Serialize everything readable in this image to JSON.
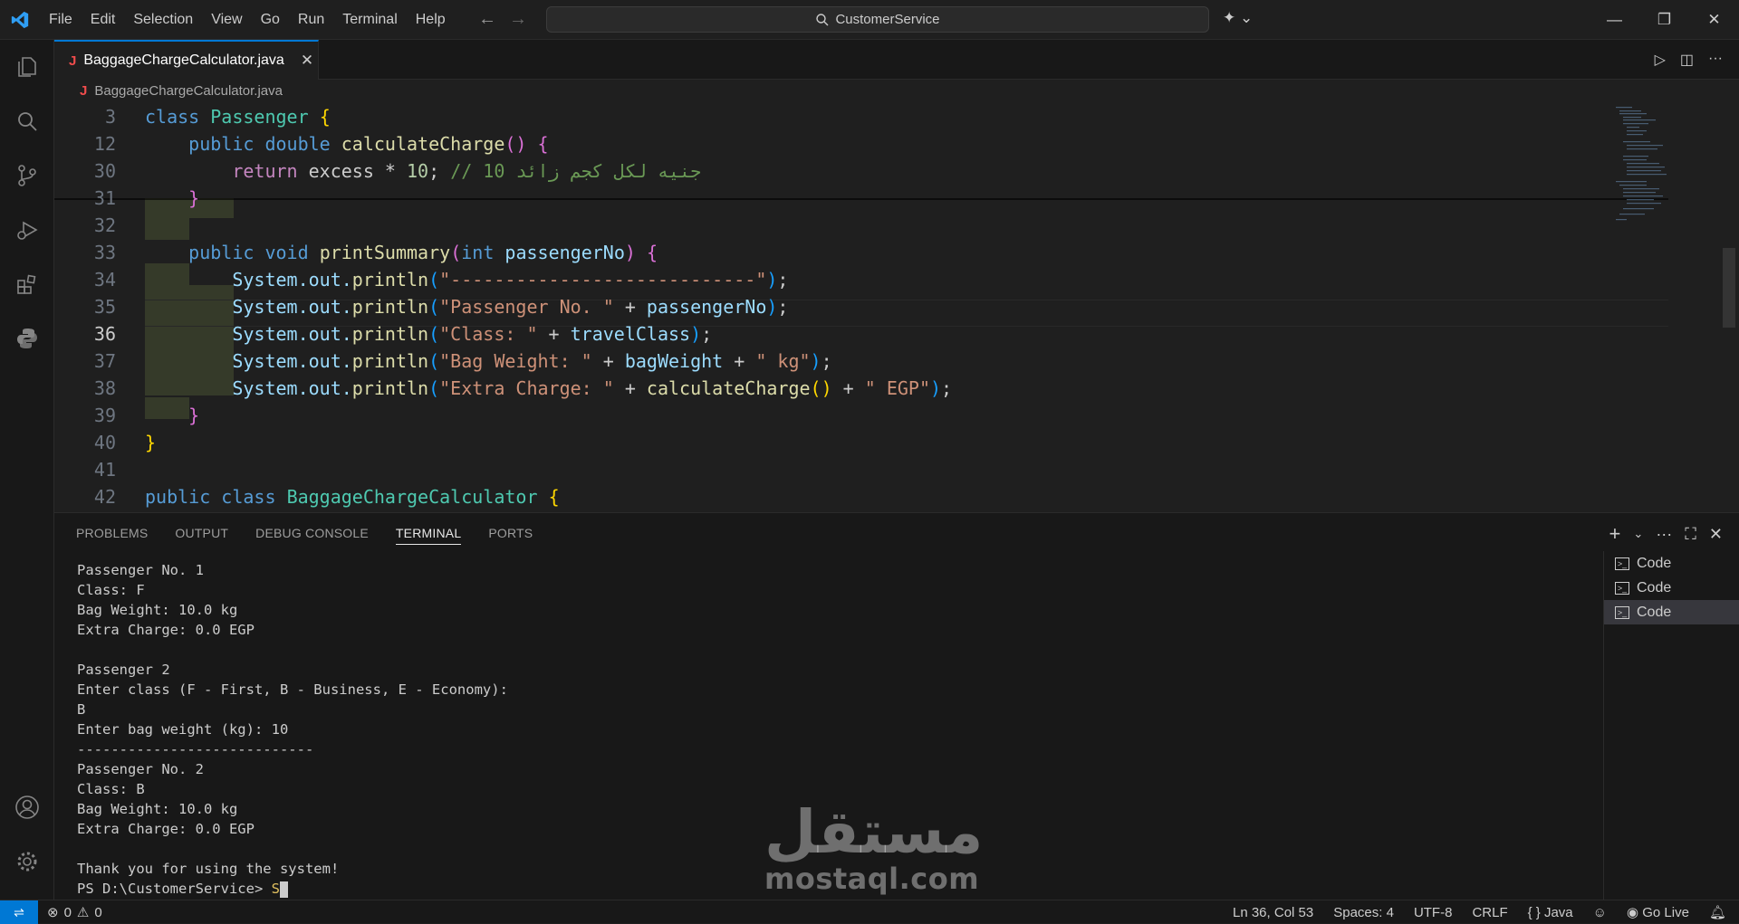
{
  "titlebar": {
    "menu": [
      "File",
      "Edit",
      "Selection",
      "View",
      "Go",
      "Run",
      "Terminal",
      "Help"
    ],
    "search_text": "CustomerService"
  },
  "editor": {
    "tab_label": "BaggageChargeCalculator.java",
    "breadcrumb": "BaggageChargeCalculator.java",
    "lines": [
      {
        "n": "3",
        "current": false
      },
      {
        "n": "12",
        "current": false
      },
      {
        "n": "30",
        "current": false
      },
      {
        "n": "31",
        "current": false
      },
      {
        "n": "32",
        "current": false
      },
      {
        "n": "33",
        "current": false
      },
      {
        "n": "34",
        "current": false
      },
      {
        "n": "35",
        "current": false
      },
      {
        "n": "36",
        "current": true
      },
      {
        "n": "37",
        "current": false
      },
      {
        "n": "38",
        "current": false
      },
      {
        "n": "39",
        "current": false
      },
      {
        "n": "40",
        "current": false
      },
      {
        "n": "41",
        "current": false
      },
      {
        "n": "42",
        "current": false
      }
    ],
    "code": {
      "l3": {
        "kw": "class",
        "name": "Passenger",
        "brace": "{"
      },
      "l12": {
        "kw1": "public",
        "kw2": "double",
        "fn": "calculateCharge",
        "parens": "()",
        "brace": "{"
      },
      "l30": {
        "kw": "return",
        "rest": "excess * ",
        "num": "10",
        "semi": ";",
        "comment": "// 10 جنيه لكل كجم زائد"
      },
      "l31": {
        "brace": "}"
      },
      "l33": {
        "kw1": "public",
        "kw2": "void",
        "fn": "printSummary",
        "p1": "(",
        "ty": "int",
        "param": "passengerNo",
        "p2": ")",
        "brace": "{"
      },
      "l34": {
        "obj": "System.out.",
        "fn": "println",
        "p1": "(",
        "str": "\"----------------------------\"",
        "p2": ")",
        "semi": ";"
      },
      "l35": {
        "obj": "System.out.",
        "fn": "println",
        "p1": "(",
        "str": "\"Passenger No. \"",
        "op": " + ",
        "var": "passengerNo",
        "p2": ")",
        "semi": ";"
      },
      "l36": {
        "obj": "System.out.",
        "fn": "println",
        "p1": "(",
        "str": "\"Class: \"",
        "op": " + ",
        "var": "travelClass",
        "p2": ")",
        "semi": ";"
      },
      "l37": {
        "obj": "System.out.",
        "fn": "println",
        "p1": "(",
        "str": "\"Bag Weight: \"",
        "op": " + ",
        "var": "bagWeight",
        "op2": " + ",
        "str2": "\" kg\"",
        "p2": ")",
        "semi": ";"
      },
      "l38": {
        "obj": "System.out.",
        "fn": "println",
        "p1": "(",
        "str": "\"Extra Charge: \"",
        "op": " + ",
        "fn2": "calculateCharge",
        "pp": "()",
        "op2": " + ",
        "str2": "\" EGP\"",
        "p2": ")",
        "semi": ";"
      },
      "l39": {
        "brace": "}"
      },
      "l40": {
        "brace": "}"
      },
      "l42": {
        "kw1": "public",
        "kw2": "class",
        "name": "BaggageChargeCalculator",
        "brace": "{"
      }
    }
  },
  "panel": {
    "tabs": [
      "PROBLEMS",
      "OUTPUT",
      "DEBUG CONSOLE",
      "TERMINAL",
      "PORTS"
    ],
    "active_tab": "TERMINAL",
    "terminal_output": "Passenger No. 1\nClass: F\nBag Weight: 10.0 kg\nExtra Charge: 0.0 EGP\n\nPassenger 2\nEnter class (F - First, B - Business, E - Economy):\nB\nEnter bag weight (kg): 10\n----------------------------\nPassenger No. 2\nClass: B\nBag Weight: 10.0 kg\nExtra Charge: 0.0 EGP\n\nThank you for using the system!",
    "prompt": "PS D:\\CustomerService> ",
    "typed": "S",
    "terminals": [
      "Code",
      "Code",
      "Code"
    ]
  },
  "statusbar": {
    "errors": "0",
    "warnings": "0",
    "position": "Ln 36, Col 53",
    "spaces": "Spaces: 4",
    "encoding": "UTF-8",
    "eol": "CRLF",
    "language": "Java",
    "golive": "Go Live"
  },
  "watermark": {
    "arabic": "مستقل",
    "latin": "mostaql.com"
  },
  "colors": {
    "accent": "#0078d4",
    "bg": "#1f1f1f"
  }
}
